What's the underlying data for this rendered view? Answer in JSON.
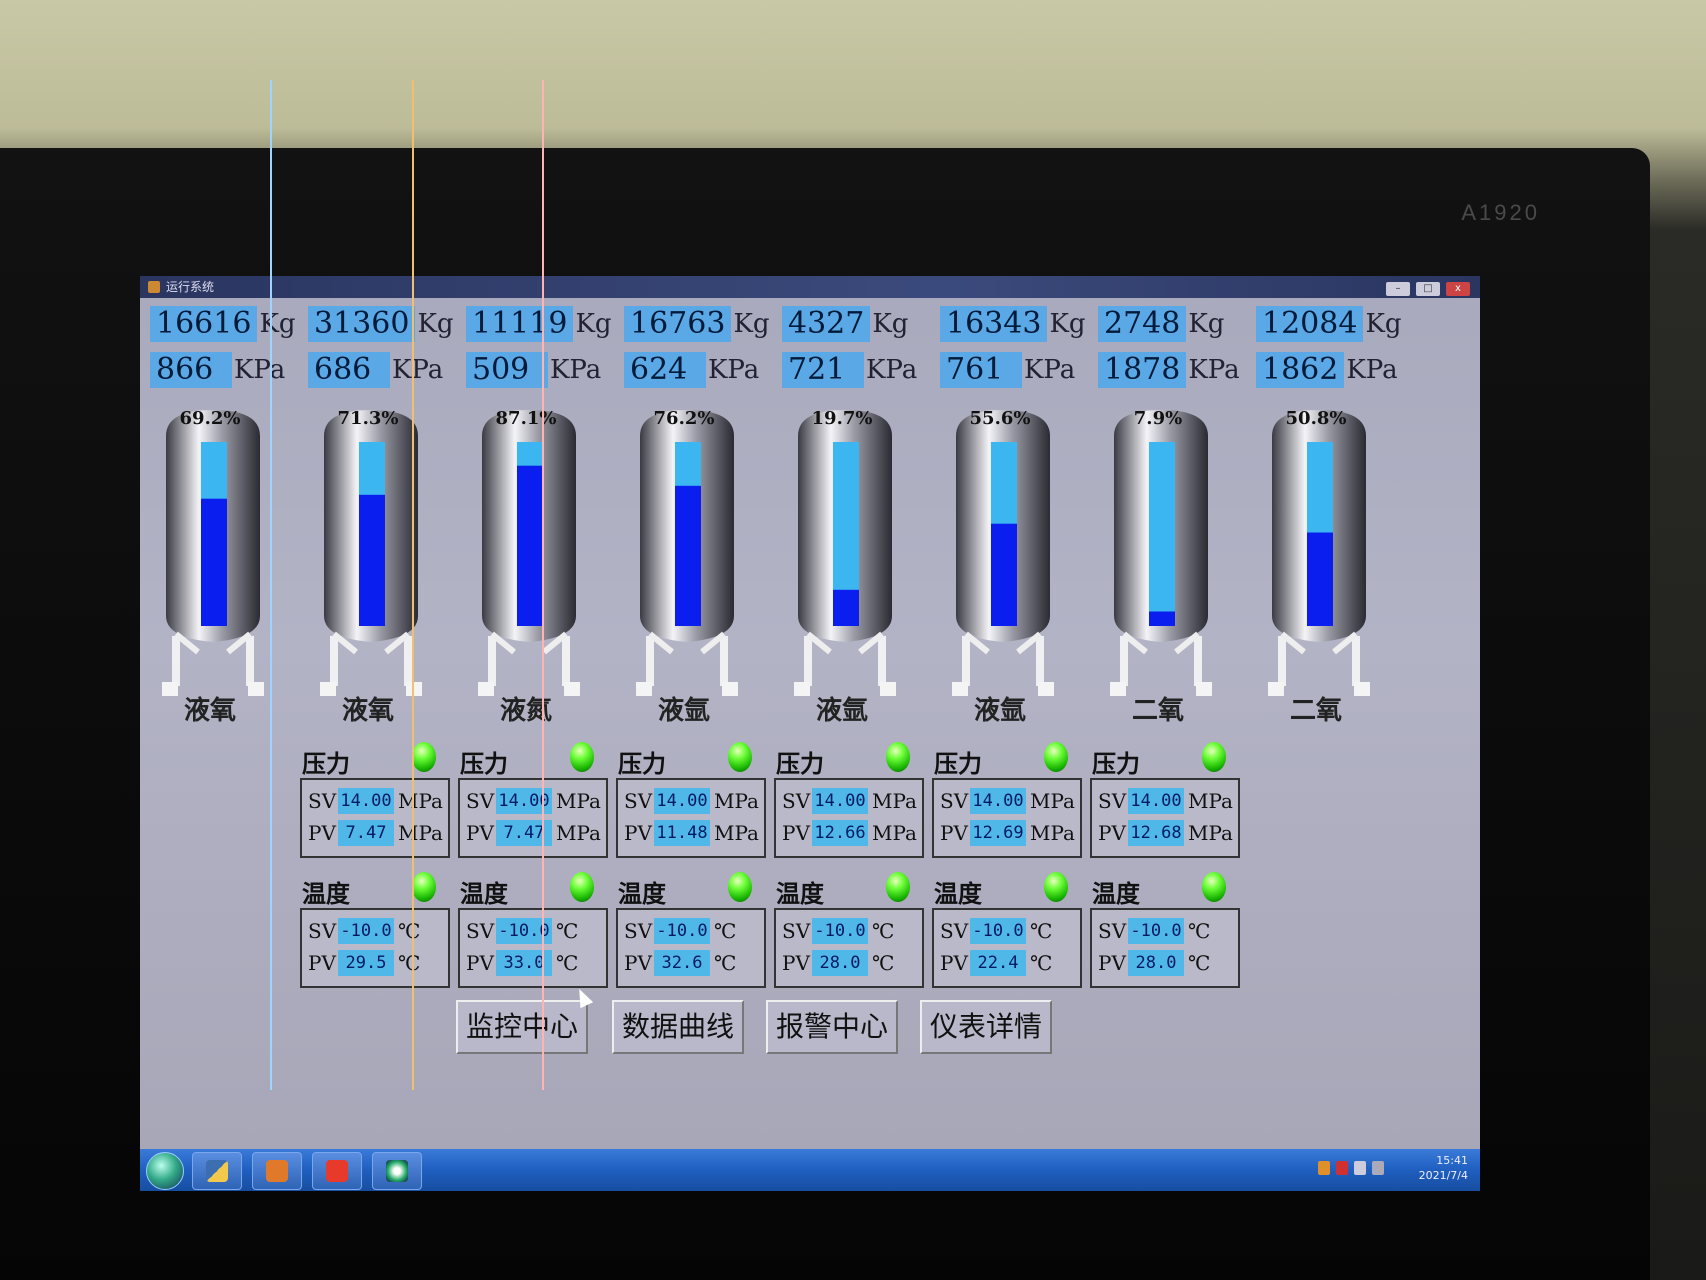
{
  "monitor": {
    "brand": "A1920"
  },
  "window": {
    "title": "运行系统",
    "minimize": "–",
    "maximize": "□",
    "close": "x"
  },
  "tanks": [
    {
      "weight": "16616",
      "weight_unit": "Kg",
      "pressure": "866",
      "pressure_unit": "KPa",
      "percent_label": "69.2%",
      "level": 0.692,
      "name": "液氧"
    },
    {
      "weight": "31360",
      "weight_unit": "Kg",
      "pressure": "686",
      "pressure_unit": "KPa",
      "percent_label": "71.3%",
      "level": 0.713,
      "name": "液氧"
    },
    {
      "weight": "11119",
      "weight_unit": "Kg",
      "pressure": "509",
      "pressure_unit": "KPa",
      "percent_label": "87.1%",
      "level": 0.871,
      "name": "液氮"
    },
    {
      "weight": "16763",
      "weight_unit": "Kg",
      "pressure": "624",
      "pressure_unit": "KPa",
      "percent_label": "76.2%",
      "level": 0.762,
      "name": "液氩"
    },
    {
      "weight": "4327",
      "weight_unit": "Kg",
      "pressure": "721",
      "pressure_unit": "KPa",
      "percent_label": "19.7%",
      "level": 0.197,
      "name": "液氩"
    },
    {
      "weight": "16343",
      "weight_unit": "Kg",
      "pressure": "761",
      "pressure_unit": "KPa",
      "percent_label": "55.6%",
      "level": 0.556,
      "name": "液氩"
    },
    {
      "weight": "2748",
      "weight_unit": "Kg",
      "pressure": "1878",
      "pressure_unit": "KPa",
      "percent_label": "7.9%",
      "level": 0.079,
      "name": "二氧"
    },
    {
      "weight": "12084",
      "weight_unit": "Kg",
      "pressure": "1862",
      "pressure_unit": "KPa",
      "percent_label": "50.8%",
      "level": 0.508,
      "name": "二氧"
    }
  ],
  "gauges": [
    {
      "pressure": {
        "title": "压力",
        "sv": "14.00",
        "pv": "7.47",
        "unit": "MPa"
      },
      "temperature": {
        "title": "温度",
        "sv": "-10.0",
        "pv": "29.5",
        "unit": "℃"
      }
    },
    {
      "pressure": {
        "title": "压力",
        "sv": "14.00",
        "pv": "7.47",
        "unit": "MPa"
      },
      "temperature": {
        "title": "温度",
        "sv": "-10.0",
        "pv": "33.0",
        "unit": "℃"
      }
    },
    {
      "pressure": {
        "title": "压力",
        "sv": "14.00",
        "pv": "11.48",
        "unit": "MPa"
      },
      "temperature": {
        "title": "温度",
        "sv": "-10.0",
        "pv": "32.6",
        "unit": "℃"
      }
    },
    {
      "pressure": {
        "title": "压力",
        "sv": "14.00",
        "pv": "12.66",
        "unit": "MPa"
      },
      "temperature": {
        "title": "温度",
        "sv": "-10.0",
        "pv": "28.0",
        "unit": "℃"
      }
    },
    {
      "pressure": {
        "title": "压力",
        "sv": "14.00",
        "pv": "12.69",
        "unit": "MPa"
      },
      "temperature": {
        "title": "温度",
        "sv": "-10.0",
        "pv": "22.4",
        "unit": "℃"
      }
    },
    {
      "pressure": {
        "title": "压力",
        "sv": "14.00",
        "pv": "12.68",
        "unit": "MPa"
      },
      "temperature": {
        "title": "温度",
        "sv": "-10.0",
        "pv": "28.0",
        "unit": "℃"
      }
    }
  ],
  "labels": {
    "sv": "SV",
    "pv": "PV"
  },
  "nav": [
    "监控中心",
    "数据曲线",
    "报警中心",
    "仪表详情"
  ],
  "taskbar": {
    "time": "15:41",
    "date": "2021/7/4"
  },
  "colors": {
    "level_high": "#0b1ef0",
    "level_low": "#3cb6f0",
    "led_green": "#18d400",
    "readout_bg": "#5aa9e6"
  }
}
